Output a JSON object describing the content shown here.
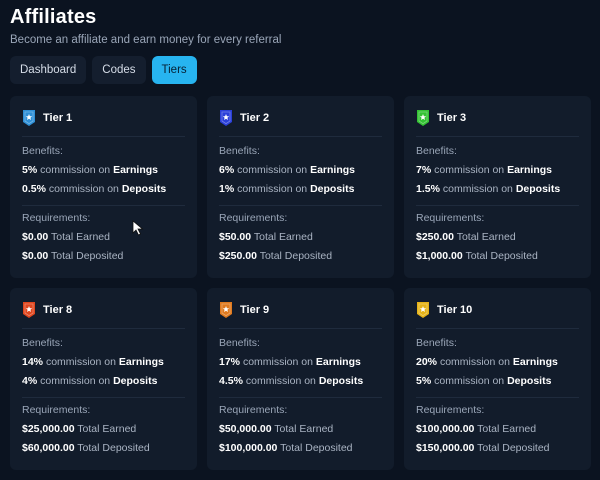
{
  "header": {
    "title": "Affiliates",
    "subtitle": "Become an affiliate and earn money for every referral"
  },
  "tabs": [
    {
      "label": "Dashboard",
      "active": false
    },
    {
      "label": "Codes",
      "active": false
    },
    {
      "label": "Tiers",
      "active": true
    }
  ],
  "labels": {
    "benefits": "Benefits:",
    "requirements": "Requirements:",
    "commission_on": "commission on",
    "earnings": "Earnings",
    "deposits": "Deposits",
    "total_earned": "Total Earned",
    "total_deposited": "Total Deposited"
  },
  "tiers": [
    {
      "name": "Tier 1",
      "color": "#2e8fd6",
      "earnings_pct": "5%",
      "deposits_pct": "0.5%",
      "req_earned": "$0.00",
      "req_deposited": "$0.00"
    },
    {
      "name": "Tier 2",
      "color": "#2a3fd9",
      "earnings_pct": "6%",
      "deposits_pct": "1%",
      "req_earned": "$50.00",
      "req_deposited": "$250.00"
    },
    {
      "name": "Tier 3",
      "color": "#33c233",
      "earnings_pct": "7%",
      "deposits_pct": "1.5%",
      "req_earned": "$250.00",
      "req_deposited": "$1,000.00"
    },
    {
      "name": "Tier 8",
      "color": "#e0461e",
      "earnings_pct": "14%",
      "deposits_pct": "4%",
      "req_earned": "$25,000.00",
      "req_deposited": "$60,000.00"
    },
    {
      "name": "Tier 9",
      "color": "#e07a1e",
      "earnings_pct": "17%",
      "deposits_pct": "4.5%",
      "req_earned": "$50,000.00",
      "req_deposited": "$100,000.00"
    },
    {
      "name": "Tier 10",
      "color": "#e6b317",
      "earnings_pct": "20%",
      "deposits_pct": "5%",
      "req_earned": "$100,000.00",
      "req_deposited": "$150,000.00"
    }
  ]
}
